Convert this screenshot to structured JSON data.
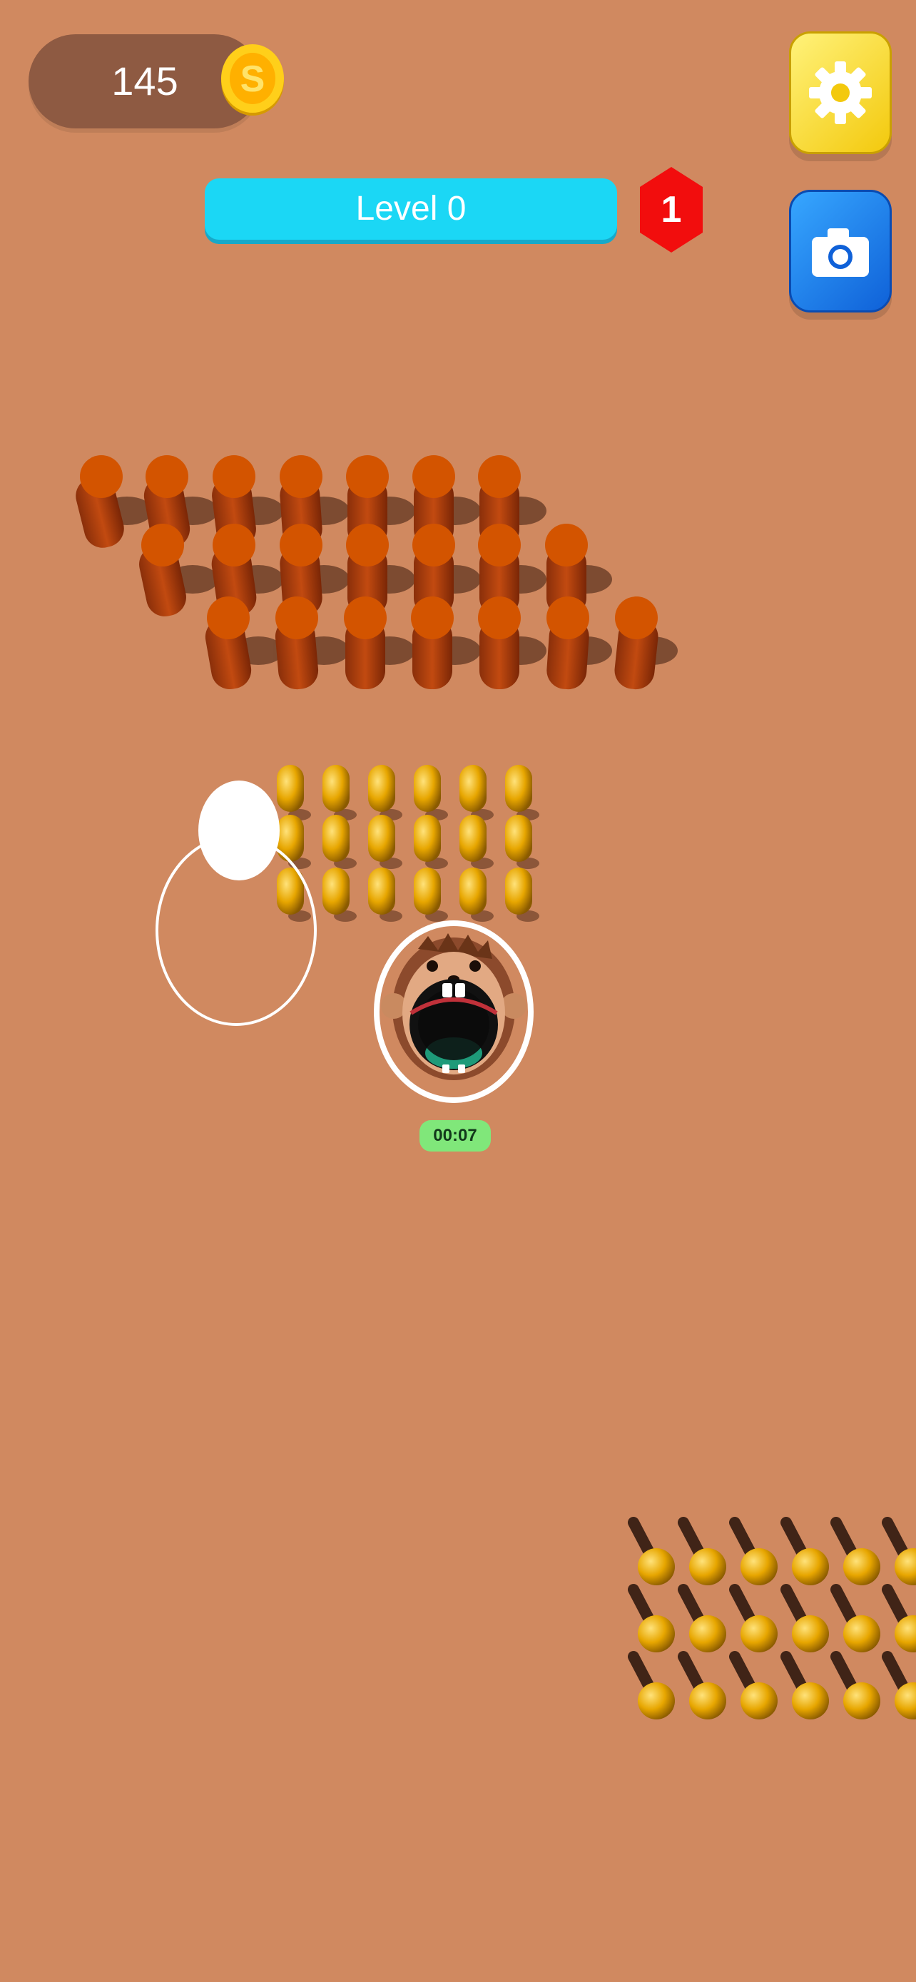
{
  "hud": {
    "coins": "145",
    "level_label": "Level 0",
    "badge_number": "1"
  },
  "player": {
    "timer": "00:07"
  },
  "icons": {
    "coin": "coin-icon",
    "settings": "gear-icon",
    "camera": "camera-icon"
  },
  "colors": {
    "ground": "#d08960",
    "coin_panel": "#8e5a42",
    "level_bar": "#1bd7f5",
    "badge": "#f20d0d",
    "settings_button": "#f3c90d",
    "camera_button": "#0f61d8",
    "log_top": "#d35400",
    "gold_piece": "#f1b400",
    "timer_bg": "#80e77a"
  }
}
